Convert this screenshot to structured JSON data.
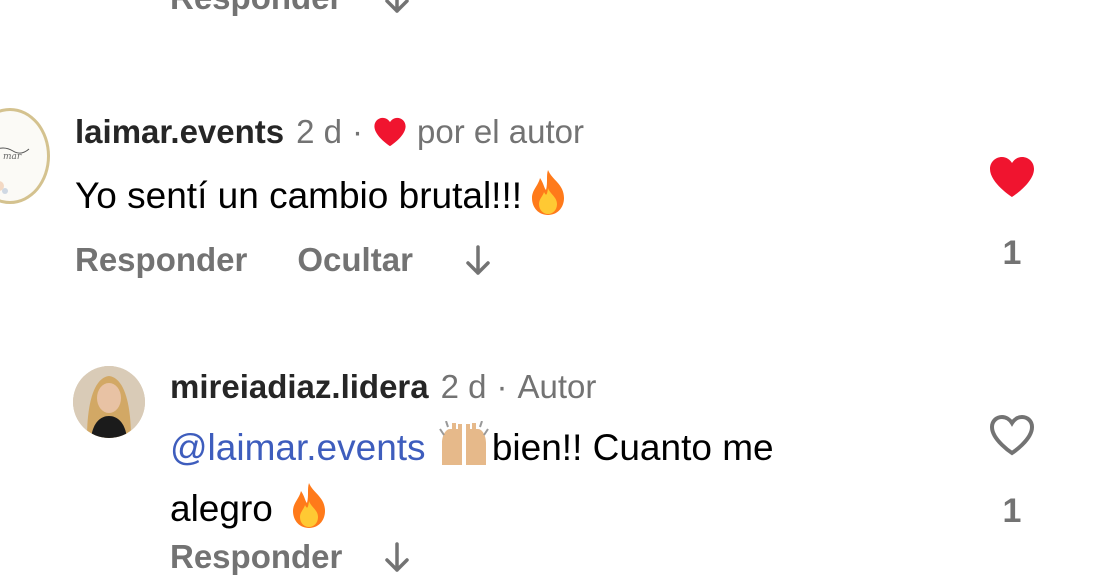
{
  "top_partial": {
    "reply_label": "Responder"
  },
  "comment1": {
    "username": "laimar.events",
    "time": "2 d",
    "liked_by_author": "por el autor",
    "text": "Yo sentí un cambio brutal!!!",
    "actions": {
      "reply": "Responder",
      "hide": "Ocultar"
    },
    "like_count": "1",
    "liked": true
  },
  "comment2": {
    "username": "mireiadiaz.lidera",
    "time": "2 d",
    "badge": "Autor",
    "mention": "@laimar.events",
    "text_line1": "bien!! Cuanto me",
    "text_line2": "alegro",
    "like_count": "1",
    "liked": false,
    "reply_label": "Responder"
  },
  "colors": {
    "heart_red": "#f0142f",
    "muted": "#737373",
    "mention": "#3e5dbd"
  }
}
